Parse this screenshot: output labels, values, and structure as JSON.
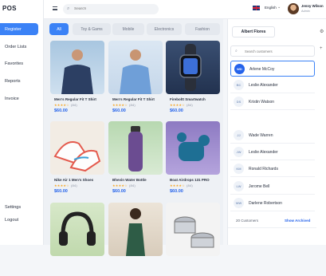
{
  "brand": "POS",
  "sidebar": {
    "items": [
      {
        "label": "Register"
      },
      {
        "label": "Order Lists"
      },
      {
        "label": "Favorites"
      },
      {
        "label": "Reports"
      },
      {
        "label": "Invoice"
      }
    ],
    "bottom": [
      {
        "label": "Settings"
      },
      {
        "label": "Logout"
      }
    ]
  },
  "header": {
    "search_placeholder": "Search",
    "language": "English",
    "user_name": "Jenny Wilson",
    "user_role": "Admin"
  },
  "categories": [
    {
      "label": "All"
    },
    {
      "label": "Toy & Gams"
    },
    {
      "label": "Mobile"
    },
    {
      "label": "Electronics"
    },
    {
      "label": "Fashion"
    }
  ],
  "products": [
    {
      "name": "Men's Regular Fit T Shirt",
      "rating": "★★★★☆",
      "reviews": "(84)",
      "price": "$60.00"
    },
    {
      "name": "Men's Regular Fit T Shirt",
      "rating": "★★★★☆",
      "reviews": "(84)",
      "price": "$60.00"
    },
    {
      "name": "Fireboltt Smartwatch",
      "rating": "★★★★☆",
      "reviews": "(84)",
      "price": "$60.00"
    },
    {
      "name": "Nike Air 1 Men's Shoes",
      "rating": "★★★★☆",
      "reviews": "(84)",
      "price": "$60.00"
    },
    {
      "name": "Bhevin Water Bottle",
      "rating": "★★★★☆",
      "reviews": "(84)",
      "price": "$60.00"
    },
    {
      "name": "Boat Airdrops 131 PRO",
      "rating": "★★★★☆",
      "reviews": "(84)",
      "price": "$60.00"
    },
    {
      "name": "",
      "rating": "",
      "reviews": "",
      "price": ""
    },
    {
      "name": "",
      "rating": "",
      "reviews": "",
      "price": ""
    },
    {
      "name": "",
      "rating": "",
      "reviews": "",
      "price": ""
    }
  ],
  "customers": {
    "selected": "Albert Flores",
    "search_placeholder": "Search customers",
    "list": [
      {
        "initials": "WD",
        "name": "Arlene McCoy"
      },
      {
        "initials": "BC",
        "name": "Leslie Alexander"
      },
      {
        "initials": "DS",
        "name": "Kristin Watson"
      },
      {
        "initials": "JJ",
        "name": "Wade Warren"
      },
      {
        "initials": "JW",
        "name": "Leslie Alexander"
      },
      {
        "initials": "KM",
        "name": "Ronald Richards"
      },
      {
        "initials": "LW",
        "name": "Jerome Bell"
      },
      {
        "initials": "WW",
        "name": "Darlene Robertson"
      }
    ],
    "count": "20 Customers",
    "archived_link": "Show Archived"
  },
  "colors": {
    "accent": "#3b82f6",
    "price": "#2563eb",
    "star": "#f5a623"
  }
}
